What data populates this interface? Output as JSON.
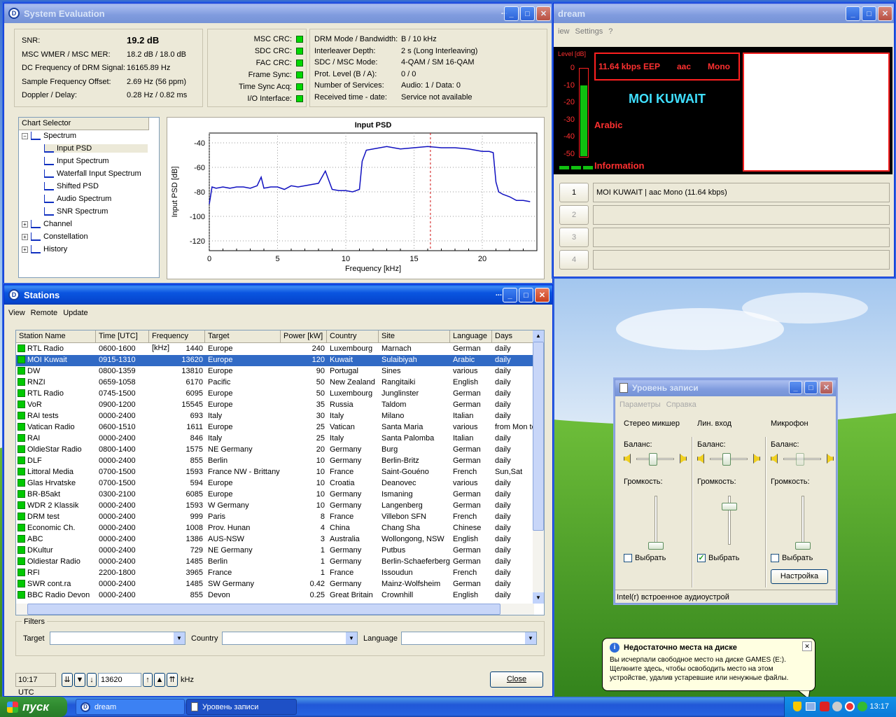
{
  "sys_eval": {
    "title": "System Evaluation",
    "params": [
      {
        "label": "SNR:",
        "value": "19.2 dB"
      },
      {
        "label": "MSC WMER / MSC MER:",
        "value": "18.2 dB / 18.0 dB"
      },
      {
        "label": "DC Frequency of DRM Signal:",
        "value": "16165.89 Hz"
      },
      {
        "label": "Sample Frequency Offset:",
        "value": "2.69 Hz (56 ppm)"
      },
      {
        "label": "Doppler / Delay:",
        "value": "0.28 Hz / 0.82 ms"
      }
    ],
    "crc": [
      "MSC CRC:",
      "SDC CRC:",
      "FAC CRC:",
      "Frame Sync:",
      "Time Sync Acq:",
      "I/O Interface:"
    ],
    "drm": [
      {
        "label": "DRM Mode / Bandwidth:",
        "value": "B / 10 kHz"
      },
      {
        "label": "Interleaver Depth:",
        "value": "2 s (Long Interleaving)"
      },
      {
        "label": "SDC / MSC Mode:",
        "value": "4-QAM / SM 16-QAM"
      },
      {
        "label": "Prot. Level (B / A):",
        "value": "0 / 0"
      },
      {
        "label": "Number of Services:",
        "value": "Audio: 1 / Data: 0"
      },
      {
        "label": "Received time - date:",
        "value": "Service not available"
      }
    ],
    "chart_selector_label": "Chart Selector",
    "tree": [
      {
        "label": "Spectrum",
        "level": 0,
        "expander": "−"
      },
      {
        "label": "Input PSD",
        "level": 1,
        "selected": true
      },
      {
        "label": "Input Spectrum",
        "level": 1
      },
      {
        "label": "Waterfall Input Spectrum",
        "level": 1
      },
      {
        "label": "Shifted PSD",
        "level": 1
      },
      {
        "label": "Audio Spectrum",
        "level": 1
      },
      {
        "label": "SNR Spectrum",
        "level": 1
      },
      {
        "label": "Channel",
        "level": 0,
        "expander": "+"
      },
      {
        "label": "Constellation",
        "level": 0,
        "expander": "+"
      },
      {
        "label": "History",
        "level": 0,
        "expander": "+"
      }
    ]
  },
  "chart_data": {
    "type": "line",
    "title": "Input PSD",
    "xlabel": "Frequency [kHz]",
    "ylabel": "Input PSD [dB]",
    "xlim": [
      0,
      24
    ],
    "ylim": [
      -128,
      -32
    ],
    "xticks": [
      0,
      5,
      10,
      15,
      20
    ],
    "yticks": [
      -40,
      -60,
      -80,
      -100,
      -120
    ],
    "marker_x": 16.2,
    "grid": true,
    "series": [
      {
        "x": [
          0,
          0.2,
          0.5,
          1,
          1.5,
          2,
          2.5,
          3,
          3.5,
          3.8,
          4,
          4.5,
          5,
          5.5,
          6,
          6.5,
          7,
          7.5,
          8,
          8.5,
          9,
          9.5,
          10,
          10.5,
          11,
          11.2,
          11.5,
          12,
          13,
          14,
          15,
          16,
          17,
          18,
          19,
          20,
          20.5,
          20.8,
          21,
          21.2,
          21.5,
          22,
          22.5,
          23,
          23.5
        ],
        "y": [
          -90,
          -76,
          -77,
          -76,
          -77,
          -76,
          -76,
          -77,
          -75,
          -68,
          -77,
          -76,
          -76,
          -78,
          -75,
          -76,
          -75,
          -74,
          -73,
          -63,
          -78,
          -79,
          -79,
          -80,
          -78,
          -55,
          -46,
          -45,
          -43,
          -45,
          -44,
          -43,
          -44,
          -44,
          -45,
          -47,
          -47,
          -48,
          -72,
          -80,
          -82,
          -84,
          -87,
          -87,
          -88
        ]
      }
    ]
  },
  "dream": {
    "title": "dream",
    "menu": [
      "iew",
      "Settings",
      "?"
    ],
    "level_label": "Level [dB]",
    "level_ticks": [
      "0",
      "-10",
      "-20",
      "-30",
      "-40",
      "-50"
    ],
    "level_fill": 0.8,
    "bitrate": "11.64 kbps EEP",
    "codec": "aac",
    "mode": "Mono",
    "station": "MOI KUWAIT",
    "language": "Arabic",
    "info_label": "Information",
    "services": [
      {
        "num": "1",
        "text": "MOI KUWAIT   |   aac Mono (11.64 kbps)"
      },
      {
        "num": "2",
        "text": ""
      },
      {
        "num": "3",
        "text": ""
      },
      {
        "num": "4",
        "text": ""
      }
    ]
  },
  "stations": {
    "title": "Stations",
    "menu": [
      "View",
      "Remote",
      "Update"
    ],
    "columns": [
      "Station Name",
      "Time [UTC]",
      "Frequency [kHz]",
      "Target",
      "Power [kW]",
      "Country",
      "Site",
      "Language",
      "Days"
    ],
    "rows": [
      [
        "RTL Radio",
        "0600-1600",
        "1440",
        "Europe",
        "240",
        "Luxembourg",
        "Marnach",
        "German",
        "daily"
      ],
      [
        "MOI Kuwait",
        "0915-1310",
        "13620",
        "Europe",
        "120",
        "Kuwait",
        "Sulaibiyah",
        "Arabic",
        "daily"
      ],
      [
        "DW",
        "0800-1359",
        "13810",
        "Europe",
        "90",
        "Portugal",
        "Sines",
        "various",
        "daily"
      ],
      [
        "RNZI",
        "0659-1058",
        "6170",
        "Pacific",
        "50",
        "New Zealand",
        "Rangitaiki",
        "English",
        "daily"
      ],
      [
        "RTL Radio",
        "0745-1500",
        "6095",
        "Europe",
        "50",
        "Luxembourg",
        "Junglinster",
        "German",
        "daily"
      ],
      [
        "VoR",
        "0900-1200",
        "15545",
        "Europe",
        "35",
        "Russia",
        "Taldom",
        "German",
        "daily"
      ],
      [
        "RAI tests",
        "0000-2400",
        "693",
        "Italy",
        "30",
        "Italy",
        "Milano",
        "Italian",
        "daily"
      ],
      [
        "Vatican Radio",
        "0600-1510",
        "1611",
        "Europe",
        "25",
        "Vatican",
        "Santa Maria",
        "various",
        "from Mon to"
      ],
      [
        "RAI",
        "0000-2400",
        "846",
        "Italy",
        "25",
        "Italy",
        "Santa Palomba",
        "Italian",
        "daily"
      ],
      [
        "OldieStar Radio",
        "0800-1400",
        "1575",
        "NE Germany",
        "20",
        "Germany",
        "Burg",
        "German",
        "daily"
      ],
      [
        "DLF",
        "0000-2400",
        "855",
        "Berlin",
        "10",
        "Germany",
        "Berlin-Britz",
        "German",
        "daily"
      ],
      [
        "Littoral Media",
        "0700-1500",
        "1593",
        "France NW - Brittany",
        "10",
        "France",
        "Saint-Gouéno",
        "French",
        "Sun,Sat"
      ],
      [
        "Glas Hrvatske",
        "0700-1500",
        "594",
        "Europe",
        "10",
        "Croatia",
        "Deanovec",
        "various",
        "daily"
      ],
      [
        "BR-B5akt",
        "0300-2100",
        "6085",
        "Europe",
        "10",
        "Germany",
        "Ismaning",
        "German",
        "daily"
      ],
      [
        "WDR 2 Klassik",
        "0000-2400",
        "1593",
        "W Germany",
        "10",
        "Germany",
        "Langenberg",
        "German",
        "daily"
      ],
      [
        "DRM test",
        "0000-2400",
        "999",
        "Paris",
        "8",
        "France",
        "Villebon SFN",
        "French",
        "daily"
      ],
      [
        "Economic Ch.",
        "0000-2400",
        "1008",
        "Prov. Hunan",
        "4",
        "China",
        "Chang Sha",
        "Chinese",
        "daily"
      ],
      [
        "ABC",
        "0000-2400",
        "1386",
        "AUS-NSW",
        "3",
        "Australia",
        "Wollongong, NSW",
        "English",
        "daily"
      ],
      [
        "DKultur",
        "0000-2400",
        "729",
        "NE Germany",
        "1",
        "Germany",
        "Putbus",
        "German",
        "daily"
      ],
      [
        "Oldiestar Radio",
        "0000-2400",
        "1485",
        "Berlin",
        "1",
        "Germany",
        "Berlin-Schaeferberg",
        "German",
        "daily"
      ],
      [
        "RFI",
        "2200-1800",
        "3965",
        "France",
        "1",
        "France",
        "Issoudun",
        "French",
        "daily"
      ],
      [
        "SWR cont.ra",
        "0000-2400",
        "1485",
        "SW Germany",
        "0.42",
        "Germany",
        "Mainz-Wolfsheim",
        "German",
        "daily"
      ],
      [
        "BBC Radio Devon",
        "0000-2400",
        "855",
        "Devon",
        "0.25",
        "Great Britain",
        "Crownhill",
        "English",
        "daily"
      ]
    ],
    "filters_label": "Filters",
    "target_label": "Target",
    "country_label": "Country",
    "language_label": "Language",
    "time": "10:17 UTC",
    "freq": "13620",
    "khz": "kHz",
    "close": "Close"
  },
  "mixer": {
    "title": "Уровень записи",
    "menu": [
      "Параметры",
      "Справка"
    ],
    "channels": [
      {
        "name": "Стерео микшер",
        "balance": "Баланс:",
        "volume": "Громкость:",
        "select": "Выбрать",
        "checked": false,
        "level": 0.0
      },
      {
        "name": "Лин. вход",
        "balance": "Баланс:",
        "volume": "Громкость:",
        "select": "Выбрать",
        "checked": true,
        "level": 0.85
      },
      {
        "name": "Микрофон",
        "balance": "Баланс:",
        "volume": "Громкость:",
        "select": "Выбрать",
        "checked": false,
        "level": 0.0
      }
    ],
    "settings_button": "Настройка",
    "status": "Intel(r) встроенное аудиоустрой"
  },
  "balloon": {
    "title": "Недостаточно места на диске",
    "text": "Вы исчерпали свободное место на диске GAMES (E:). Щелкните здесь, чтобы освободить место на этом устройстве, удалив устаревшие или ненужные файлы."
  },
  "taskbar": {
    "start": "пуск",
    "tasks": [
      "dream",
      "Уровень записи"
    ],
    "clock": "13:17"
  },
  "colors": {
    "accent": "#316ac5",
    "led": "#00d800",
    "dream_red": "#ff2020",
    "dream_cyan": "#40e0ff"
  }
}
